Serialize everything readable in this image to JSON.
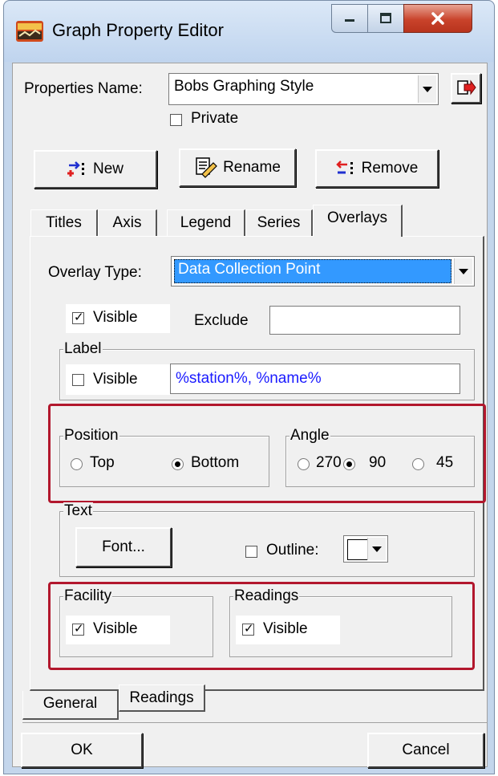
{
  "window": {
    "title": "Graph Property Editor",
    "icon": "app-icon",
    "controls": [
      "minimize-icon",
      "maximize-icon",
      "close-icon"
    ]
  },
  "properties": {
    "name_label": "Properties Name:",
    "name_value": "Bobs Graphing Style",
    "private_label": "Private",
    "private_checked": false
  },
  "toolbar": {
    "new_label": "New",
    "rename_label": "Rename",
    "remove_label": "Remove"
  },
  "tabs": {
    "items": [
      "Titles",
      "Axis",
      "Legend",
      "Series",
      "Overlays"
    ],
    "active": "Overlays"
  },
  "overlay": {
    "type_label": "Overlay Type:",
    "type_value": "Data Collection Point",
    "visible_label": "Visible",
    "visible_checked": true,
    "exclude_label": "Exclude",
    "exclude_value": ""
  },
  "label_group": {
    "title": "Label",
    "visible_label": "Visible",
    "visible_checked": false,
    "format_value": "%station%, %name%"
  },
  "position_group": {
    "title": "Position",
    "options": [
      "Top",
      "Bottom"
    ],
    "selected": "Bottom"
  },
  "angle_group": {
    "title": "Angle",
    "options": [
      "270",
      "90",
      "45"
    ],
    "selected": "90"
  },
  "text_group": {
    "title": "Text",
    "font_button": "Font...",
    "outline_label": "Outline:",
    "outline_checked": false
  },
  "facility_group": {
    "title": "Facility",
    "visible_label": "Visible",
    "visible_checked": true
  },
  "readings_group": {
    "title": "Readings",
    "visible_label": "Visible",
    "visible_checked": true
  },
  "subtabs": {
    "items": [
      "General",
      "Readings"
    ],
    "active": "General"
  },
  "footer": {
    "ok_label": "OK",
    "cancel_label": "Cancel"
  },
  "colors": {
    "highlight": "#b2172d",
    "selection": "#3399ff",
    "format_text": "#1a1aff"
  }
}
